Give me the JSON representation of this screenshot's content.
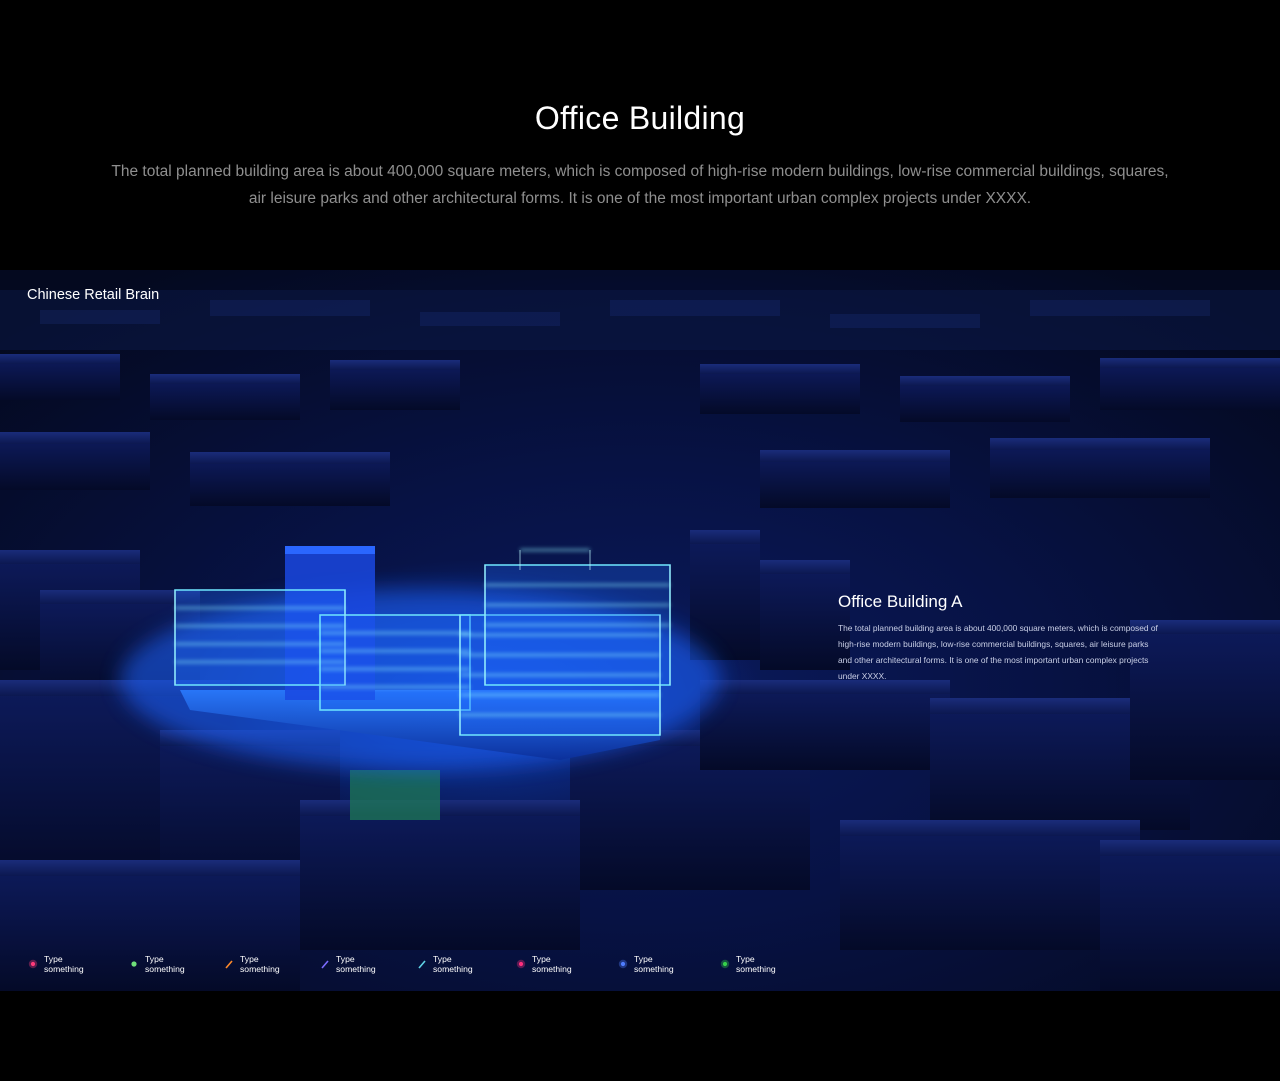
{
  "header": {
    "title": "Office Building",
    "description_lines": [
      "The total planned building area is about 400,000 square meters, which is composed of high-rise modern buildings, low-rise commercial buildings, squares,",
      "air leisure parks and other architectural forms. It is one of the most important urban complex projects under XXXX."
    ]
  },
  "scene": {
    "label": "Chinese Retail Brain",
    "card": {
      "title": "Office Building A",
      "body_lines": [
        "The total planned building area is about 400,000 square meters, which is composed of",
        "high-rise modern buildings, low-rise commercial buildings, squares, air leisure parks",
        "and other architectural forms. It is one of the most important urban complex projects",
        "under XXXX."
      ]
    }
  },
  "legend": [
    {
      "label": "Type something",
      "icon": "ring-dot-icon",
      "color": "#ff3b7a"
    },
    {
      "label": "Type something",
      "icon": "dot-icon",
      "color": "#6fe07a"
    },
    {
      "label": "Type something",
      "icon": "slash-icon",
      "color": "#ff8a2a"
    },
    {
      "label": "Type something",
      "icon": "slash-icon",
      "color": "#7b6cff"
    },
    {
      "label": "Type something",
      "icon": "slash-icon",
      "color": "#5fd3e6"
    },
    {
      "label": "Type something",
      "icon": "ring-dot-icon",
      "color": "#ff2f7d"
    },
    {
      "label": "Type something",
      "icon": "ring-dot-icon",
      "color": "#4f7dff"
    },
    {
      "label": "Type something",
      "icon": "ring-dot-icon",
      "color": "#35d24a"
    }
  ],
  "colors": {
    "background": "#000000",
    "scene_glow": "#1f6bff",
    "wireframe": "#6fe6ff"
  }
}
